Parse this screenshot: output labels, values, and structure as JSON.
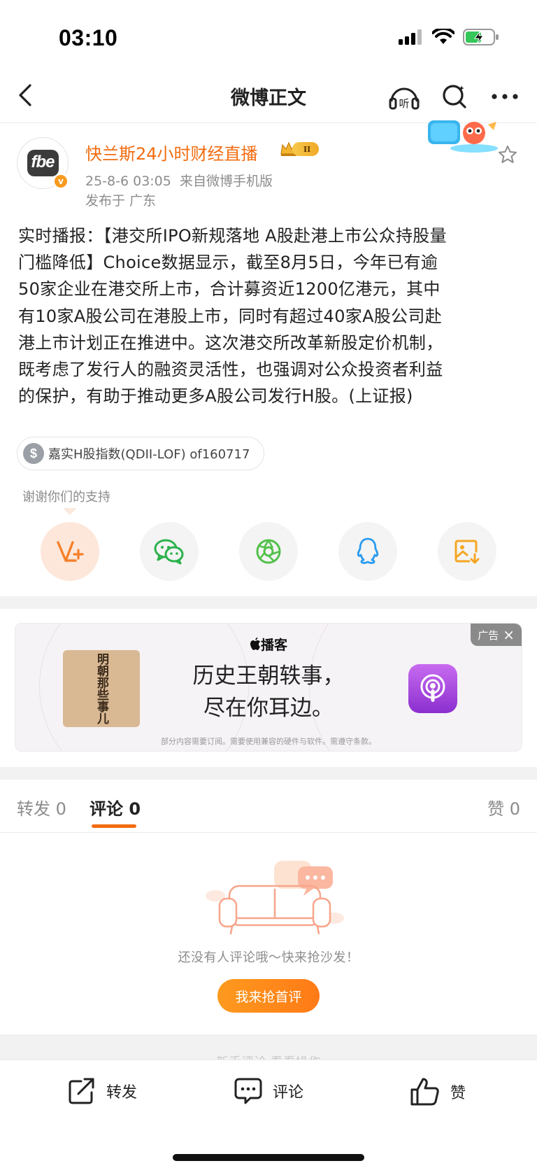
{
  "status_bar": {
    "time": "03:10"
  },
  "nav": {
    "title": "微博正文",
    "listen_label": "听"
  },
  "author": {
    "name": "快兰斯24小时财经直播",
    "avatar_text": "fbe",
    "verified_mark": "v",
    "badge_level": "II",
    "timestamp": "25-8-6 03:05",
    "source": "来自微博手机版",
    "location": "发布于 广东"
  },
  "post": {
    "lines": [
      "实时播报：【港交所IPO新规落地 A股赴港上市公众持股量",
      "门槛降低】Choice数据显示，截至8月5日，今年已有逾",
      "50家企业在港交所上市，合计募资近1200亿港元，其中",
      "有10家A股公司在港股上市，同时有超过40家A股公司赴",
      "港上市计划正在推进中。这次港交所改革新股定价机制，",
      "既考虑了发行人的融资灵活性，也强调对公众投资者利益",
      "的保护，有助于推动更多A股公司发行H股。(上证报)"
    ]
  },
  "tag": {
    "icon": "$",
    "label": "嘉实H股指数(QDII-LOF) of160717"
  },
  "support": {
    "thanks_text": "谢谢你们的支持"
  },
  "share": {
    "items": [
      "v-plus-icon",
      "wechat-icon",
      "moments-icon",
      "qq-icon",
      "save-image-icon"
    ]
  },
  "ad": {
    "brand": "播客",
    "headline_line1": "历史王朝轶事，",
    "headline_line2": "尽在你耳边。",
    "cover_text": "明朝那些事儿",
    "footnote": "部分内容需要订阅。需要使用兼容的硬件与软件。需遵守条款。",
    "label": "广告",
    "close": "×"
  },
  "tabs": {
    "repost": "转发 0",
    "comment": "评论 0",
    "like": "赞 0"
  },
  "empty": {
    "text": "还没有人评论哦～快来抢沙发！",
    "button": "我来抢首评"
  },
  "faded_text": "新手评论  看看操作",
  "bottom": {
    "repost": "转发",
    "comment": "评论",
    "like": "赞"
  },
  "colors": {
    "accent": "#f26c10",
    "button": "#ff8a1a",
    "ad_icon": "#a94bdc"
  }
}
